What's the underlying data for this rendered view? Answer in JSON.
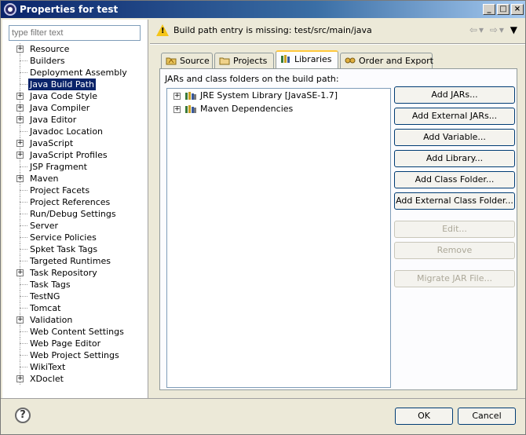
{
  "window": {
    "title": "Properties for test"
  },
  "filter": {
    "placeholder": "type filter text"
  },
  "tree": {
    "items": [
      {
        "label": "Resource",
        "expandable": true
      },
      {
        "label": "Builders",
        "expandable": false
      },
      {
        "label": "Deployment Assembly",
        "expandable": false
      },
      {
        "label": "Java Build Path",
        "expandable": false,
        "selected": true
      },
      {
        "label": "Java Code Style",
        "expandable": true
      },
      {
        "label": "Java Compiler",
        "expandable": true
      },
      {
        "label": "Java Editor",
        "expandable": true
      },
      {
        "label": "Javadoc Location",
        "expandable": false
      },
      {
        "label": "JavaScript",
        "expandable": true
      },
      {
        "label": "JavaScript Profiles",
        "expandable": true
      },
      {
        "label": "JSP Fragment",
        "expandable": false
      },
      {
        "label": "Maven",
        "expandable": true
      },
      {
        "label": "Project Facets",
        "expandable": false
      },
      {
        "label": "Project References",
        "expandable": false
      },
      {
        "label": "Run/Debug Settings",
        "expandable": false
      },
      {
        "label": "Server",
        "expandable": false
      },
      {
        "label": "Service Policies",
        "expandable": false
      },
      {
        "label": "Spket Task Tags",
        "expandable": false
      },
      {
        "label": "Targeted Runtimes",
        "expandable": false
      },
      {
        "label": "Task Repository",
        "expandable": true
      },
      {
        "label": "Task Tags",
        "expandable": false
      },
      {
        "label": "TestNG",
        "expandable": false
      },
      {
        "label": "Tomcat",
        "expandable": false
      },
      {
        "label": "Validation",
        "expandable": true
      },
      {
        "label": "Web Content Settings",
        "expandable": false
      },
      {
        "label": "Web Page Editor",
        "expandable": false
      },
      {
        "label": "Web Project Settings",
        "expandable": false
      },
      {
        "label": "WikiText",
        "expandable": false
      },
      {
        "label": "XDoclet",
        "expandable": true
      }
    ]
  },
  "header": {
    "message": "Build path entry is missing: test/src/main/java",
    "back_icon": "arrow-left-icon",
    "forward_icon": "arrow-right-icon",
    "menu_icon": "chevron-down-icon"
  },
  "tabs": [
    {
      "label": "Source",
      "icon": "source-folder-icon"
    },
    {
      "label": "Projects",
      "icon": "projects-icon"
    },
    {
      "label": "Libraries",
      "icon": "libraries-icon",
      "active": true
    },
    {
      "label": "Order and Export",
      "icon": "order-export-icon"
    }
  ],
  "libraries": {
    "caption": "JARs and class folders on the build path:",
    "entries": [
      {
        "label": "JRE System Library [JavaSE-1.7]",
        "icon": "library-icon"
      },
      {
        "label": "Maven Dependencies",
        "icon": "library-icon"
      }
    ]
  },
  "buttons": {
    "add_jars": "Add JARs...",
    "add_external_jars": "Add External JARs...",
    "add_variable": "Add Variable...",
    "add_library": "Add Library...",
    "add_class_folder": "Add Class Folder...",
    "add_external_class_folder": "Add External Class Folder...",
    "edit": "Edit...",
    "remove": "Remove",
    "migrate_jar": "Migrate JAR File...",
    "ok": "OK",
    "cancel": "Cancel"
  },
  "colors": {
    "selection": "#0a246a",
    "warning": "#f5c518",
    "tab_highlight": "#ffc83c"
  }
}
